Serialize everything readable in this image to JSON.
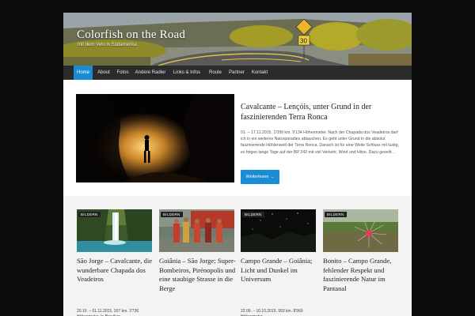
{
  "site": {
    "title": "Colorfish on the Road",
    "tagline": "mit dem Velo in Südamerika"
  },
  "nav": {
    "items": [
      {
        "label": "Home",
        "active": true
      },
      {
        "label": "About",
        "active": false
      },
      {
        "label": "Fotos",
        "active": false
      },
      {
        "label": "Andere Radler",
        "active": false
      },
      {
        "label": "Links & Infos",
        "active": false
      },
      {
        "label": "Route",
        "active": false
      },
      {
        "label": "Partner",
        "active": false
      },
      {
        "label": "Kontakt",
        "active": false
      }
    ]
  },
  "featured": {
    "title": "Cavalcante – Lençóis, unter Grund in der faszinierenden Terra Ronca",
    "excerpt": "01. – 17.11.2015. 1'099 km. 9'134 Höhenmeter. Nach der Chapada dos Veadeiros darf ich in ein weiteres Naturparadies abtauchen. Es geht unter Grund in die absolut faszinierende Höhlenwelt der Terra Ronca. Danach ist für eine Weile Schluss mit lustig, es folgen lange Tage auf der BR 242 mit viel Verkehr, Wind und Hitze. Dazu gesellt…",
    "button": "Weiterlesen →"
  },
  "posts": [
    {
      "badge": "BILDERN",
      "title": "São Jorge – Cavalcante, die wunderbare Chapada dos Veadeiros",
      "meta": "20.10. – 01.11.2015. 207 km. 3'736 Höhenmeter. In Brasilien"
    },
    {
      "badge": "BILDERN",
      "title": "Goiânia – São Jorge; Super-Bombeiros, Pirénopolis und eine staubige Strasse in die Berge",
      "meta": ""
    },
    {
      "badge": "BILDERN",
      "title": "Campo Grande – Goiânia; Licht und Dunkel im Universum",
      "meta": "22.09. – 10.10.2015. 993 km. 8'969 Höhenmeter."
    },
    {
      "badge": "BILDERN",
      "title": "Bonito – Campo Grande, fehlender Respekt und faszinierende Natur im Pantanal",
      "meta": ""
    }
  ],
  "colors": {
    "accent": "#1b8bd3",
    "nav_bg": "#2b2b2b",
    "body_bg": "#0d0d0d"
  }
}
